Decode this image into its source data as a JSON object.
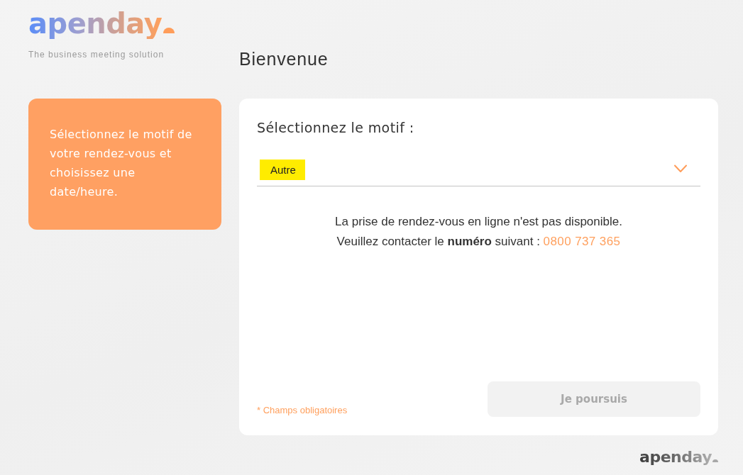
{
  "brand": {
    "logo": "apenday",
    "tagline": "The business meeting solution"
  },
  "page_title": "Bienvenue",
  "info_panel": {
    "text": "Sélectionnez le motif de votre rendez-vous et choisissez une date/heure."
  },
  "form": {
    "label": "Sélectionnez le motif :",
    "motif_select": {
      "value": "Autre",
      "highlighted": true
    },
    "message": {
      "lines": [
        "La prise de rendez-vous en ligne n'est pas disponible.",
        "Veuillez contacter le **numéro** suivant :"
      ],
      "phone": "0800 737 365"
    },
    "required_note": "* Champs obligatoires",
    "submit": {
      "label": "Je poursuis",
      "disabled": true
    }
  },
  "footer": {
    "logo": "apenday"
  }
}
